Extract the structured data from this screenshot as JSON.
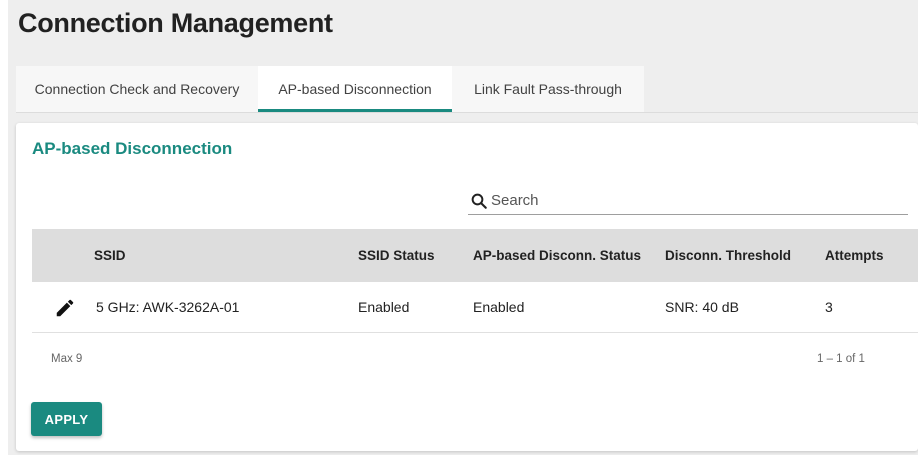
{
  "page": {
    "title": "Connection Management"
  },
  "tabs": [
    {
      "label": "Connection Check and Recovery",
      "active": false
    },
    {
      "label": "AP-based Disconnection",
      "active": true
    },
    {
      "label": "Link Fault Pass-through",
      "active": false
    }
  ],
  "section": {
    "title": "AP-based Disconnection"
  },
  "search": {
    "placeholder": "Search",
    "value": "",
    "icon": "search-icon"
  },
  "table": {
    "columns": [
      "SSID",
      "SSID Status",
      "AP-based Disconn. Status",
      "Disconn. Threshold",
      "Attempts"
    ],
    "rows": [
      {
        "ssid": "5 GHz: AWK-3262A-01",
        "ssid_status": "Enabled",
        "ap_status": "Enabled",
        "threshold": "SNR: 40 dB",
        "attempts": "3",
        "action_icon": "edit-pencil-icon"
      }
    ],
    "footer_left": "Max 9",
    "footer_right": "1 – 1 of 1"
  },
  "actions": {
    "apply_label": "APPLY"
  },
  "colors": {
    "accent": "#1a8a80",
    "header_bg": "#dddddd",
    "page_bg": "#eeeeee"
  }
}
